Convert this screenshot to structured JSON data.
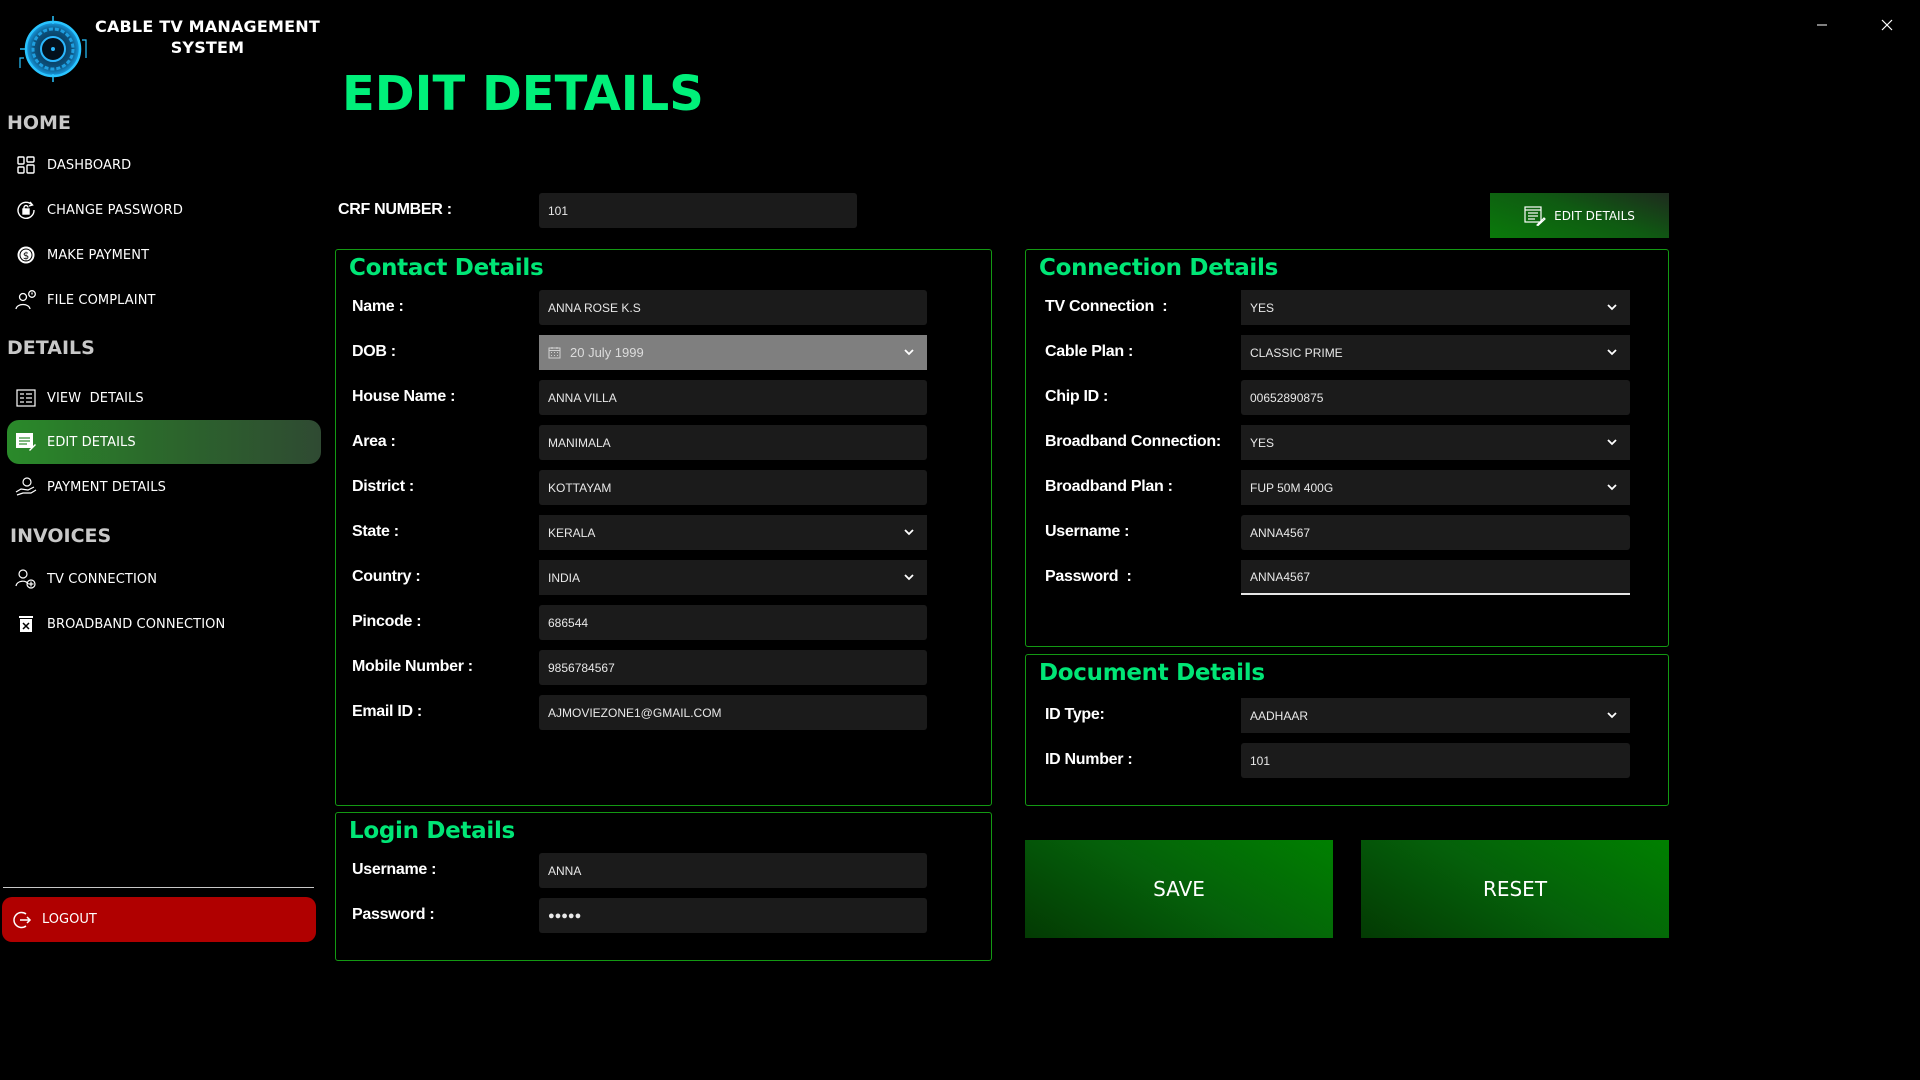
{
  "app": {
    "title": "CABLE TV MANAGEMENT SYSTEM",
    "logo_icon": "target-logo-icon",
    "window_controls": {
      "minimize_icon": "minimize-icon",
      "close_icon": "close-icon"
    }
  },
  "sidebar": {
    "sections": [
      {
        "heading": "HOME",
        "items": [
          {
            "label": "DASHBOARD",
            "icon": "dashboard-grid-icon"
          },
          {
            "label": "CHANGE PASSWORD",
            "icon": "lock-refresh-icon"
          },
          {
            "label": "MAKE PAYMENT",
            "icon": "dollar-coin-icon"
          },
          {
            "label": "FILE COMPLAINT",
            "icon": "person-alert-icon"
          }
        ]
      },
      {
        "heading": "DETAILS",
        "items": [
          {
            "label": "VIEW  DETAILS",
            "icon": "list-icon"
          },
          {
            "label": "EDIT DETAILS",
            "icon": "edit-list-icon",
            "active": true
          },
          {
            "label": "PAYMENT DETAILS",
            "icon": "hand-coin-icon"
          }
        ]
      },
      {
        "heading": "INVOICES",
        "items": [
          {
            "label": "TV CONNECTION",
            "icon": "user-add-icon"
          },
          {
            "label": "BROADBAND CONNECTION",
            "icon": "delete-bin-icon"
          }
        ]
      }
    ],
    "logout": {
      "label": "LOGOUT",
      "icon": "logout-icon"
    }
  },
  "main": {
    "title": "EDIT DETAILS",
    "crf": {
      "label": "CRF NUMBER :",
      "value": "101"
    },
    "edit_button": {
      "label": "EDIT DETAILS",
      "icon": "edit-list-icon"
    },
    "contact": {
      "title": "Contact Details",
      "fields": [
        {
          "label": "Name :",
          "value": "ANNA ROSE K.S",
          "type": "text"
        },
        {
          "label": "DOB :",
          "value": "20 July 1999",
          "type": "date"
        },
        {
          "label": "House Name :",
          "value": "ANNA VILLA",
          "type": "text"
        },
        {
          "label": "Area :",
          "value": "MANIMALA",
          "type": "text"
        },
        {
          "label": "District :",
          "value": "KOTTAYAM",
          "type": "text"
        },
        {
          "label": "State :",
          "value": "KERALA",
          "type": "select"
        },
        {
          "label": "Country :",
          "value": "INDIA",
          "type": "select"
        },
        {
          "label": "Pincode :",
          "value": "686544",
          "type": "text"
        },
        {
          "label": "Mobile Number :",
          "value": "9856784567",
          "type": "text"
        },
        {
          "label": "Email ID :",
          "value": "AJMOVIEZONE1@GMAIL.COM",
          "type": "text"
        }
      ]
    },
    "login": {
      "title": "Login Details",
      "fields": [
        {
          "label": "Username :",
          "value": "ANNA",
          "type": "text"
        },
        {
          "label": "Password :",
          "value": "●●●●●",
          "type": "password"
        }
      ]
    },
    "connection": {
      "title": "Connection Details",
      "fields": [
        {
          "label": "TV Connection  :",
          "value": "YES",
          "type": "select"
        },
        {
          "label": "Cable Plan :",
          "value": "CLASSIC PRIME",
          "type": "select"
        },
        {
          "label": "Chip ID :",
          "value": "00652890875",
          "type": "text"
        },
        {
          "label": "Broadband Connection:",
          "value": "YES",
          "type": "select"
        },
        {
          "label": "Broadband Plan :",
          "value": "FUP 50M 400G",
          "type": "select"
        },
        {
          "label": "Username :",
          "value": "ANNA4567",
          "type": "text"
        },
        {
          "label": "Password  :",
          "value": "ANNA4567",
          "type": "text",
          "focused": true
        }
      ]
    },
    "document": {
      "title": "Document Details",
      "fields": [
        {
          "label": "ID Type:",
          "value": "AADHAAR",
          "type": "select"
        },
        {
          "label": "ID Number :",
          "value": "101",
          "type": "text"
        }
      ]
    },
    "save_label": "SAVE",
    "reset_label": "RESET"
  },
  "colors": {
    "accent_green": "#00e676",
    "panel_border": "#139913",
    "logout_red": "#b00000",
    "field_bg": "#1b1b1b"
  }
}
